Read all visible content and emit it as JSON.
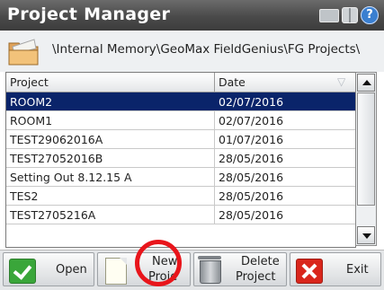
{
  "window": {
    "title": "Project Manager"
  },
  "title_icons": [
    "card-icon",
    "grid-icon",
    "help-icon"
  ],
  "path_bar": {
    "path": "\\Internal Memory\\GeoMax FieldGenius\\FG Projects\\",
    "icon": "folder-icon"
  },
  "table": {
    "columns": [
      "Project",
      "Date"
    ],
    "rows": [
      {
        "project": "ROOM2",
        "date": "02/07/2016",
        "selected": true
      },
      {
        "project": "ROOM1",
        "date": "02/07/2016"
      },
      {
        "project": "TEST29062016A",
        "date": "01/07/2016"
      },
      {
        "project": "TEST27052016B",
        "date": "28/05/2016"
      },
      {
        "project": "Setting Out 8.12.15 A",
        "date": "28/05/2016"
      },
      {
        "project": "TES2",
        "date": "28/05/2016"
      },
      {
        "project": "TEST2705216A",
        "date": "28/05/2016"
      }
    ],
    "selected_color": "#0a246a"
  },
  "toolbar": {
    "open": "Open",
    "new_line1": "New",
    "new_line2": "Proje",
    "delete_line1": "Delete",
    "delete_line2": "Project",
    "exit": "Exit"
  },
  "annotation_color": "#e8151b"
}
